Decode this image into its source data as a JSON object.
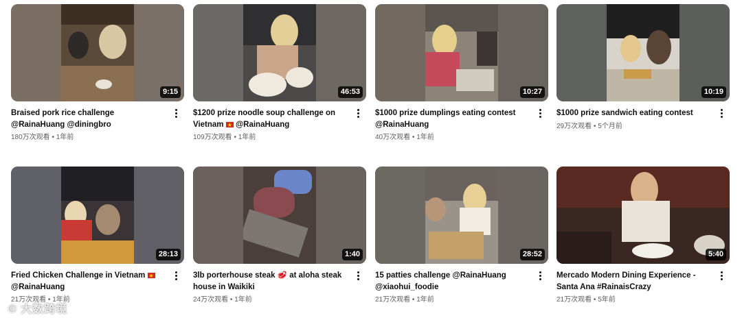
{
  "videos": [
    {
      "title": "Braised pork rice challenge @RainaHuang @diningbro",
      "views": "180万次观看",
      "age": "1年前",
      "duration": "9:15",
      "flag": false
    },
    {
      "title": "$1200 prize noodle soup challenge on Vietnam",
      "title_suffix": "@RainaHuang",
      "views": "109万次观看",
      "age": "1年前",
      "duration": "46:53",
      "flag": true
    },
    {
      "title": "$1000 prize dumplings eating contest @RainaHuang",
      "views": "40万次观看",
      "age": "1年前",
      "duration": "10:27",
      "flag": false
    },
    {
      "title": "$1000 prize sandwich eating contest",
      "views": "29万次观看",
      "age": "5个月前",
      "duration": "10:19",
      "flag": false
    },
    {
      "title": "Fried Chicken Challenge in Vietnam",
      "title_suffix": "@RainaHuang",
      "views": "21万次观看",
      "age": "1年前",
      "duration": "28:13",
      "flag": true
    },
    {
      "title": "3lb porterhouse steak 🥩 at aloha steak house in Waikiki",
      "views": "24万次观看",
      "age": "1年前",
      "duration": "1:40",
      "flag": false
    },
    {
      "title": "15 patties challenge @RainaHuang @xiaohui_foodie",
      "views": "21万次观看",
      "age": "1年前",
      "duration": "28:52",
      "flag": false
    },
    {
      "title": "Mercado Modern Dining Experience - Santa Ana #RainaisCrazy",
      "views": "21万次观看",
      "age": "5年前",
      "duration": "5:40",
      "flag": false
    }
  ],
  "separator": "•",
  "watermark": "© 大数跨境",
  "colors": {
    "text": "#0f0f0f",
    "meta": "#606060",
    "badge": "#000000"
  }
}
